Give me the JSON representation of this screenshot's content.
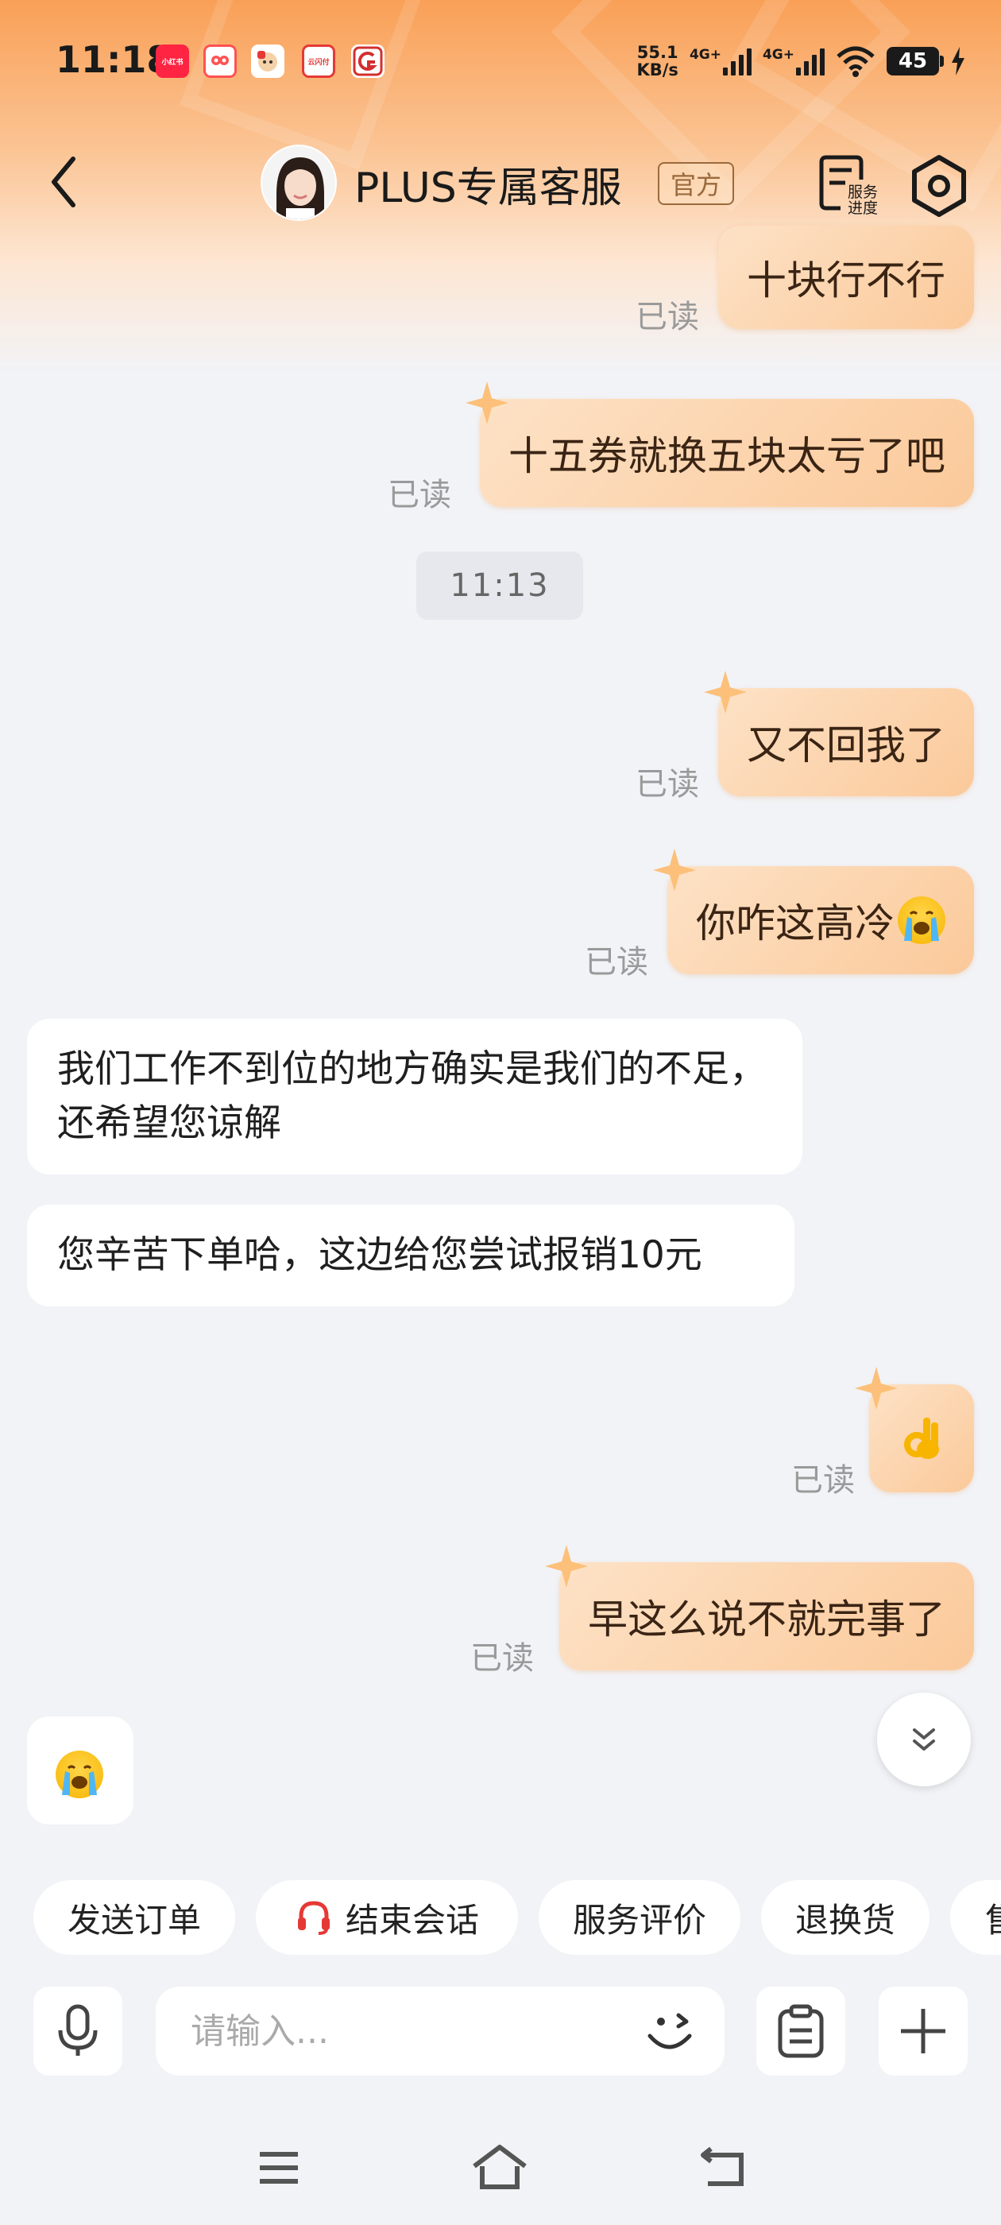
{
  "status_bar": {
    "time": "11:18",
    "notifications": [
      {
        "icon": "xiaohongshu-icon",
        "label": "小红书",
        "color": "#ff2442"
      },
      {
        "icon": "owl-app-icon",
        "label": "",
        "color": "#ff5252"
      },
      {
        "icon": "dog-app-icon",
        "label": "",
        "color": "#e53935"
      },
      {
        "icon": "yunshanfu-icon",
        "label": "云闪付",
        "color": "#e53935"
      },
      {
        "icon": "bank-app-icon",
        "label": "",
        "color": "#d32f2f"
      }
    ],
    "net_speed_value": "55.1",
    "net_speed_unit": "KB/s",
    "signal1_label": "4G+",
    "signal2_label": "4G+",
    "battery": "45"
  },
  "header": {
    "title": "PLUS专属客服",
    "official_tag": "官方",
    "progress_label_line1": "服务",
    "progress_label_line2": "进度"
  },
  "messages": [
    {
      "dir": "out",
      "text": "十块行不行",
      "read": "已读"
    },
    {
      "dir": "out",
      "text": "十五券就换五块太亏了吧",
      "read": "已读"
    },
    {
      "dir": "time",
      "text": "11:13"
    },
    {
      "dir": "out",
      "text": "又不回我了",
      "read": "已读"
    },
    {
      "dir": "out",
      "text": "你咋这高冷",
      "emoji": "loudly-crying-emoji",
      "read": "已读"
    },
    {
      "dir": "in",
      "text": "我们工作不到位的地方确实是我们的不足，还希望您谅解"
    },
    {
      "dir": "in",
      "text": "您辛苦下单哈，这边给您尝试报销10元"
    },
    {
      "dir": "out",
      "emoji": "ok-hand-emoji",
      "read": "已读"
    },
    {
      "dir": "out",
      "text": "早这么说不就完事了",
      "read": "已读"
    },
    {
      "dir": "in",
      "emoji": "loudly-crying-emoji"
    }
  ],
  "quick_actions": [
    "发送订单",
    "结束会话",
    "服务评价",
    "退换货",
    "售"
  ],
  "input": {
    "placeholder": "请输入..."
  },
  "colors": {
    "accent": "#f9a057",
    "bubble_out_start": "#fde2c6",
    "bubble_out_end": "#fbc99a",
    "official_tag": "#9b6a3c",
    "end_session_icon": "#e53935"
  }
}
